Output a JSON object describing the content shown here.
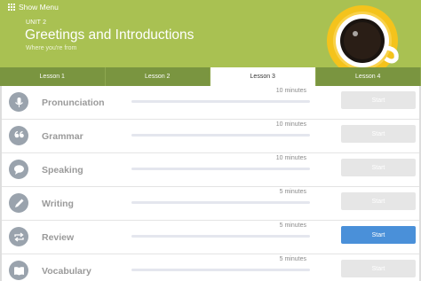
{
  "menu": {
    "label": "Show Menu"
  },
  "unit": {
    "label": "UNIT 2",
    "title": "Greetings and Introductions",
    "subtitle": "Where you're from"
  },
  "tabs": [
    {
      "label": "Lesson 1",
      "active": false
    },
    {
      "label": "Lesson 2",
      "active": false
    },
    {
      "label": "Lesson 3",
      "active": true
    },
    {
      "label": "Lesson 4",
      "active": false
    }
  ],
  "activities": [
    {
      "label": "Pronunciation",
      "duration": "10 minutes",
      "icon": "microphone-icon",
      "button": "Start",
      "progress": 0
    },
    {
      "label": "Grammar",
      "duration": "10 minutes",
      "icon": "quote-icon",
      "button": "Start",
      "progress": 0
    },
    {
      "label": "Speaking",
      "duration": "10 minutes",
      "icon": "speech-bubble-icon",
      "button": "Start",
      "progress": 0
    },
    {
      "label": "Writing",
      "duration": "5 minutes",
      "icon": "pencil-icon",
      "button": "Start",
      "progress": 0
    },
    {
      "label": "Review",
      "duration": "5 minutes",
      "icon": "repeat-icon",
      "button": "Start",
      "progress": 0
    },
    {
      "label": "Vocabulary",
      "duration": "5 minutes",
      "icon": "book-icon",
      "button": "Start",
      "progress": 0
    }
  ],
  "colors": {
    "header": "#a9c152",
    "tab": "#7a9540",
    "primary_button": "#4a90d9",
    "disabled_button": "#e6e6e6",
    "icon_circle": "#9aa3ad"
  }
}
